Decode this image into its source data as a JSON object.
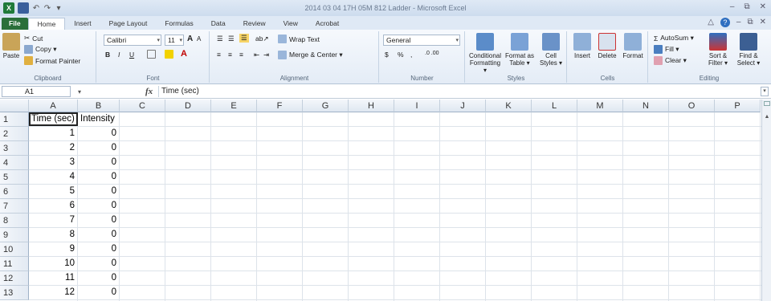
{
  "window": {
    "title": "2014 03 04 17H 05M 812 Ladder - Microsoft Excel",
    "controls": [
      "–",
      "⧉",
      "✕"
    ]
  },
  "tabs": [
    "File",
    "Home",
    "Insert",
    "Page Layout",
    "Formulas",
    "Data",
    "Review",
    "View",
    "Acrobat"
  ],
  "active_tab": "Home",
  "ribbon": {
    "clipboard": {
      "paste": "Paste",
      "cut": "Cut",
      "copy": "Copy ▾",
      "format_painter": "Format Painter",
      "label": "Clipboard"
    },
    "font": {
      "name": "Calibri",
      "size": "11",
      "bold": "B",
      "italic": "I",
      "underline": "U",
      "grow": "A",
      "shrink": "A",
      "label": "Font"
    },
    "alignment": {
      "wrap": "Wrap Text",
      "merge": "Merge & Center ▾",
      "label": "Alignment"
    },
    "number": {
      "format": "General",
      "currency": "$",
      "percent": "%",
      "comma": ",",
      "inc_dec": ".0 .00",
      "label": "Number"
    },
    "styles": {
      "conditional": "Conditional Formatting ▾",
      "format_table": "Format as Table ▾",
      "cell_styles": "Cell Styles ▾",
      "label": "Styles"
    },
    "cells": {
      "insert": "Insert",
      "delete": "Delete",
      "format": "Format",
      "label": "Cells"
    },
    "editing": {
      "autosum": "AutoSum ▾",
      "fill": "Fill ▾",
      "clear": "Clear ▾",
      "sort": "Sort & Filter ▾",
      "find": "Find & Select ▾",
      "label": "Editing"
    }
  },
  "formula_bar": {
    "name_box": "A1",
    "fx": "fx",
    "content": "Time (sec)"
  },
  "columns": [
    "A",
    "B",
    "C",
    "D",
    "E",
    "F",
    "G",
    "H",
    "I",
    "J",
    "K",
    "L",
    "M",
    "N",
    "O",
    "P"
  ],
  "rows": [
    "1",
    "2",
    "3",
    "4",
    "5",
    "6",
    "7",
    "8",
    "9",
    "10",
    "11",
    "12",
    "13"
  ],
  "sheet": {
    "headers": [
      "Time (sec)",
      "Intensity"
    ],
    "data": [
      [
        "1",
        "0"
      ],
      [
        "2",
        "0"
      ],
      [
        "3",
        "0"
      ],
      [
        "4",
        "0"
      ],
      [
        "5",
        "0"
      ],
      [
        "6",
        "0"
      ],
      [
        "7",
        "0"
      ],
      [
        "8",
        "0"
      ],
      [
        "9",
        "0"
      ],
      [
        "10",
        "0"
      ],
      [
        "11",
        "0"
      ],
      [
        "12",
        "0"
      ]
    ]
  }
}
